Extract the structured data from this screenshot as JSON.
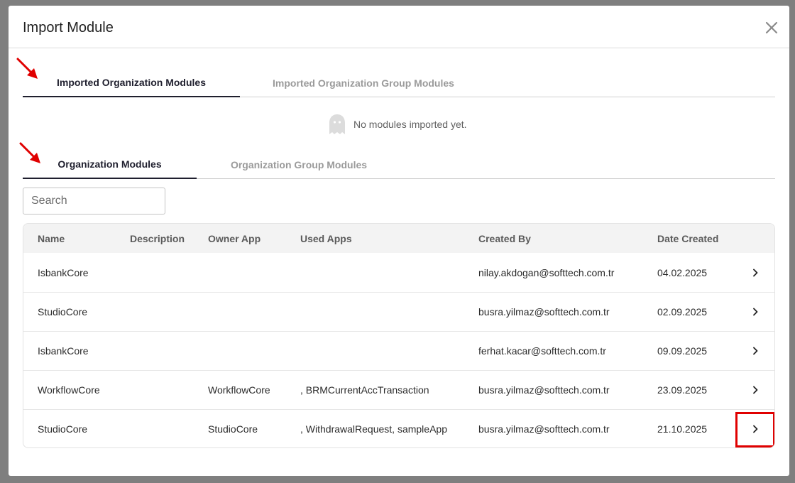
{
  "dialog": {
    "title": "Import Module",
    "close_icon": "close-icon"
  },
  "imported_tabs": [
    {
      "label": "Imported Organization Modules",
      "active": true
    },
    {
      "label": "Imported Organization Group Modules",
      "active": false
    }
  ],
  "empty_state": {
    "icon": "ghost-icon",
    "text": "No modules imported yet."
  },
  "module_tabs": [
    {
      "label": "Organization Modules",
      "active": true
    },
    {
      "label": "Organization Group Modules",
      "active": false
    }
  ],
  "search": {
    "placeholder": "Search",
    "value": ""
  },
  "table": {
    "columns": [
      "Name",
      "Description",
      "Owner App",
      "Used Apps",
      "Created By",
      "Date Created"
    ],
    "rows": [
      {
        "name": "IsbankCore",
        "description": "",
        "owner_app": "",
        "used_apps": "",
        "created_by": "nilay.akdogan@softtech.com.tr",
        "date_created": "04.02.2025"
      },
      {
        "name": "StudioCore",
        "description": "",
        "owner_app": "",
        "used_apps": "",
        "created_by": "busra.yilmaz@softtech.com.tr",
        "date_created": "02.09.2025"
      },
      {
        "name": "IsbankCore",
        "description": "",
        "owner_app": "",
        "used_apps": "",
        "created_by": "ferhat.kacar@softtech.com.tr",
        "date_created": "09.09.2025"
      },
      {
        "name": "WorkflowCore",
        "description": "",
        "owner_app": "WorkflowCore",
        "used_apps": ", BRMCurrentAccTransaction",
        "created_by": "busra.yilmaz@softtech.com.tr",
        "date_created": "23.09.2025"
      },
      {
        "name": "StudioCore",
        "description": "",
        "owner_app": "StudioCore",
        "used_apps": ", WithdrawalRequest, sampleApp",
        "created_by": "busra.yilmaz@softtech.com.tr",
        "date_created": "21.10.2025"
      }
    ],
    "row_action_icon": "chevron-right-icon"
  },
  "annotation_colors": {
    "arrow": "#e00000",
    "highlight": "#e00000"
  }
}
